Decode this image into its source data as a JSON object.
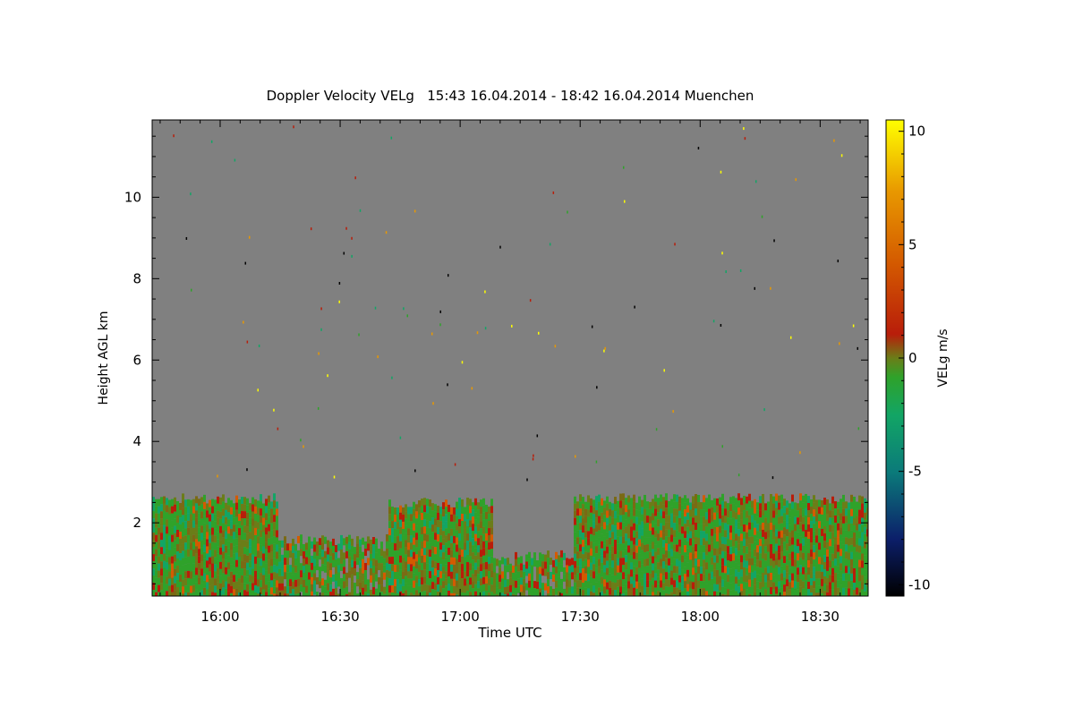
{
  "chart_data": {
    "type": "heatmap",
    "title": "Doppler Velocity VELg   15:43 16.04.2014 - 18:42 16.04.2014 Muenchen",
    "xlabel": "Time UTC",
    "ylabel": "Height AGL km",
    "colorbar_label": "VELg m/s",
    "x_range": [
      "15:43",
      "18:42"
    ],
    "x_ticks": [
      "16:00",
      "16:30",
      "17:00",
      "17:30",
      "18:00",
      "18:30"
    ],
    "y_range": [
      0.2,
      11.9
    ],
    "y_ticks": [
      2,
      4,
      6,
      8,
      10
    ],
    "color_range": [
      -10.5,
      10.5
    ],
    "color_ticks": [
      10,
      5,
      0,
      -5,
      -10
    ],
    "background_color": "#808080",
    "colormap": [
      "#000000",
      "#0c1f6a",
      "#0b7a7a",
      "#12a565",
      "#2fa22a",
      "#6b7d18",
      "#b81d0a",
      "#d45a00",
      "#e89800",
      "#ffff00"
    ],
    "echo_layers": [
      {
        "name": "boundary-layer echo",
        "segments": [
          {
            "start": "15:43",
            "end": "16:14",
            "top_km": 2.6
          },
          {
            "start": "16:14",
            "end": "16:42",
            "top_km": 1.6
          },
          {
            "start": "16:42",
            "end": "17:08",
            "top_km": 2.5
          },
          {
            "start": "17:08",
            "end": "17:28",
            "top_km": 1.2
          },
          {
            "start": "17:28",
            "end": "18:42",
            "top_km": 2.6
          }
        ]
      }
    ]
  }
}
